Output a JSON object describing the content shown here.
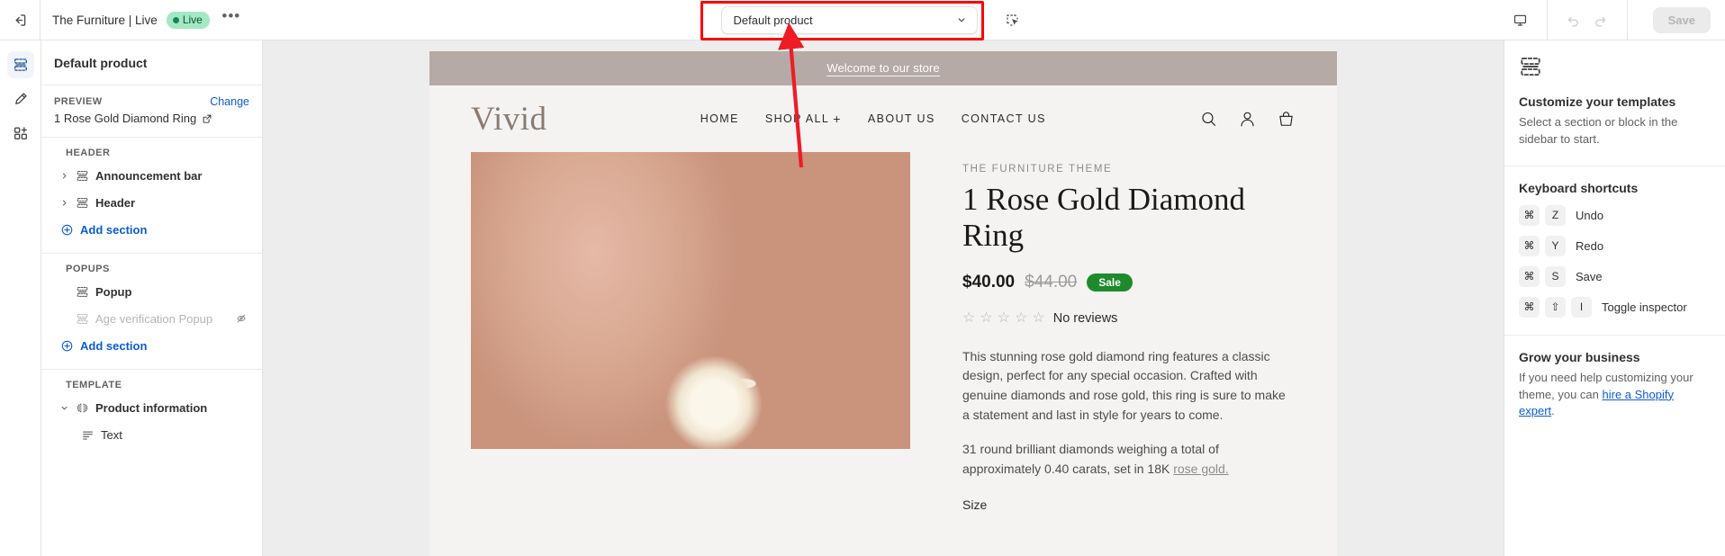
{
  "topbar": {
    "exit_icon": "exit-icon",
    "shop_title": "The Furniture | Live",
    "live_badge": "Live",
    "more_label": "•••",
    "product_select_value": "Default product",
    "inspect_icon": "inspector-select-icon",
    "device_icon": "desktop-icon",
    "undo_icon": "undo-icon",
    "redo_icon": "redo-icon",
    "save_label": "Save"
  },
  "rail": {
    "items": [
      {
        "icon": "sections-icon",
        "name": "sections",
        "active": true
      },
      {
        "icon": "theme-settings-icon",
        "name": "theme-settings",
        "active": false
      },
      {
        "icon": "apps-icon",
        "name": "apps",
        "active": false
      }
    ]
  },
  "sidebar": {
    "title": "Default product",
    "preview_label": "PREVIEW",
    "change_label": "Change",
    "preview_value": "1 Rose Gold Diamond Ring",
    "groups": [
      {
        "label": "HEADER",
        "rows": [
          {
            "label": "Announcement bar",
            "icon": "section-icon",
            "caret": true,
            "muted": false,
            "indent": false,
            "hidden_icon": false
          },
          {
            "label": "Header",
            "icon": "section-icon",
            "caret": true,
            "muted": false,
            "indent": false,
            "hidden_icon": false
          }
        ],
        "add_label": "Add section"
      },
      {
        "label": "POPUPS",
        "rows": [
          {
            "label": "Popup",
            "icon": "section-icon",
            "caret": false,
            "muted": false,
            "indent": false,
            "hidden_icon": false
          },
          {
            "label": "Age verification Popup",
            "icon": "section-icon",
            "caret": false,
            "muted": true,
            "indent": false,
            "hidden_icon": true
          }
        ],
        "add_label": "Add section"
      },
      {
        "label": "TEMPLATE",
        "rows": [
          {
            "label": "Product information",
            "icon": "two-column-icon",
            "caret": true,
            "caret_open": true,
            "muted": false,
            "indent": false,
            "hidden_icon": false
          },
          {
            "label": "Text",
            "icon": "text-block-icon",
            "caret": false,
            "muted": false,
            "indent": true,
            "hidden_icon": false
          }
        ],
        "add_label": ""
      }
    ]
  },
  "store": {
    "announcement": "Welcome to our store",
    "logo": "Vivid",
    "nav": [
      {
        "label": "HOME",
        "has_plus": false
      },
      {
        "label": "SHOP ALL",
        "has_plus": true
      },
      {
        "label": "ABOUT US",
        "has_plus": false
      },
      {
        "label": "CONTACT US",
        "has_plus": false
      }
    ],
    "header_icons": [
      "search-icon",
      "account-icon",
      "cart-icon"
    ],
    "product": {
      "vendor": "THE FURNITURE THEME",
      "title": "1 Rose Gold Diamond Ring",
      "price": "$40.00",
      "compare_price": "$44.00",
      "sale_badge": "Sale",
      "stars": "☆☆☆☆☆",
      "reviews": "No reviews",
      "description_1": "This stunning rose gold diamond ring features a classic design, perfect for any special occasion. Crafted with genuine diamonds and rose gold, this ring is sure to make a statement and last in style for years to come.",
      "description_2_pre": "31 round brilliant diamonds weighing a total of approximately 0.40 carats, set in 18K ",
      "description_2_link": "rose gold.",
      "size_label": "Size"
    }
  },
  "inspector": {
    "panel_icon": "sections-icon",
    "heading": "Customize your templates",
    "subtext": "Select a section or block in the sidebar to start.",
    "shortcuts_heading": "Keyboard shortcuts",
    "shortcuts": [
      {
        "keys": [
          "⌘",
          "Z"
        ],
        "name": "Undo"
      },
      {
        "keys": [
          "⌘",
          "Y"
        ],
        "name": "Redo"
      },
      {
        "keys": [
          "⌘",
          "S"
        ],
        "name": "Save"
      },
      {
        "keys": [
          "⌘",
          "⇧",
          "I"
        ],
        "name": "Toggle inspector"
      }
    ],
    "grow_heading": "Grow your business",
    "grow_pre": "If you need help customizing your theme, you can ",
    "grow_link": "hire a Shopify expert",
    "grow_post": "."
  },
  "annotation": {
    "highlight_color": "#fb0407",
    "arrow_color": "#ee1c25"
  }
}
